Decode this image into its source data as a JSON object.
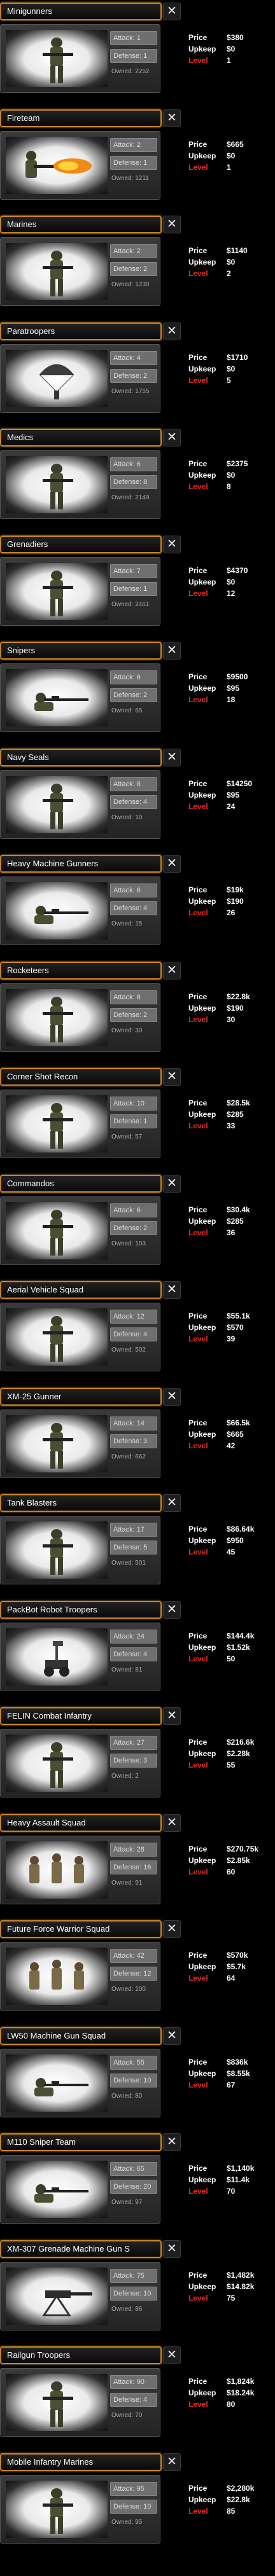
{
  "labels": {
    "attack": "Attack:",
    "defense": "Defense:",
    "owned": "Owned:",
    "price": "Price",
    "upkeep": "Upkeep",
    "level": "Level",
    "close": "✕"
  },
  "units": [
    {
      "name": "Minigunners",
      "attack": "1",
      "defense": "1",
      "owned": "2252",
      "price": "$380",
      "upkeep": "$0",
      "level": "1",
      "figure": "soldier-figure"
    },
    {
      "name": "Fireteam",
      "attack": "2",
      "defense": "1",
      "owned": "1211",
      "price": "$665",
      "upkeep": "$0",
      "level": "1",
      "figure": "flamethrower-figure"
    },
    {
      "name": "Marines",
      "attack": "2",
      "defense": "2",
      "owned": "1230",
      "price": "$1140",
      "upkeep": "$0",
      "level": "2",
      "figure": "soldier-figure"
    },
    {
      "name": "Paratroopers",
      "attack": "4",
      "defense": "2",
      "owned": "1755",
      "price": "$1710",
      "upkeep": "$0",
      "level": "5",
      "figure": "parachute-figure"
    },
    {
      "name": "Medics",
      "attack": "6",
      "defense": "8",
      "owned": "2149",
      "price": "$2375",
      "upkeep": "$0",
      "level": "8",
      "figure": "soldier-figure"
    },
    {
      "name": "Grenadiers",
      "attack": "7",
      "defense": "1",
      "owned": "2461",
      "price": "$4370",
      "upkeep": "$0",
      "level": "12",
      "figure": "soldier-figure"
    },
    {
      "name": "Snipers",
      "attack": "6",
      "defense": "2",
      "owned": "65",
      "price": "$9500",
      "upkeep": "$95",
      "level": "18",
      "figure": "sniper-figure"
    },
    {
      "name": "Navy Seals",
      "attack": "8",
      "defense": "4",
      "owned": "10",
      "price": "$14250",
      "upkeep": "$95",
      "level": "24",
      "figure": "soldier-figure"
    },
    {
      "name": "Heavy Machine Gunners",
      "attack": "6",
      "defense": "4",
      "owned": "15",
      "price": "$19k",
      "upkeep": "$190",
      "level": "26",
      "figure": "sniper-figure"
    },
    {
      "name": "Rocketeers",
      "attack": "8",
      "defense": "2",
      "owned": "30",
      "price": "$22.8k",
      "upkeep": "$190",
      "level": "30",
      "figure": "soldier-figure"
    },
    {
      "name": "Corner Shot Recon",
      "attack": "10",
      "defense": "1",
      "owned": "57",
      "price": "$28.5k",
      "upkeep": "$285",
      "level": "33",
      "figure": "soldier-figure"
    },
    {
      "name": "Commandos",
      "attack": "6",
      "defense": "2",
      "owned": "103",
      "price": "$30.4k",
      "upkeep": "$285",
      "level": "36",
      "figure": "soldier-figure"
    },
    {
      "name": "Aerial Vehicle Squad",
      "attack": "12",
      "defense": "4",
      "owned": "502",
      "price": "$55.1k",
      "upkeep": "$570",
      "level": "39",
      "figure": "soldier-figure"
    },
    {
      "name": "XM-25 Gunner",
      "attack": "14",
      "defense": "3",
      "owned": "662",
      "price": "$66.5k",
      "upkeep": "$665",
      "level": "42",
      "figure": "soldier-figure"
    },
    {
      "name": "Tank Blasters",
      "attack": "17",
      "defense": "5",
      "owned": "501",
      "price": "$86.64k",
      "upkeep": "$950",
      "level": "45",
      "figure": "soldier-figure"
    },
    {
      "name": "PackBot Robot Troopers",
      "attack": "24",
      "defense": "4",
      "owned": "81",
      "price": "$144.4k",
      "upkeep": "$1.52k",
      "level": "50",
      "figure": "robot-figure"
    },
    {
      "name": "FELIN Combat Infantry",
      "attack": "27",
      "defense": "3",
      "owned": "2",
      "price": "$216.6k",
      "upkeep": "$2.28k",
      "level": "55",
      "figure": "soldier-figure"
    },
    {
      "name": "Heavy Assault Squad",
      "attack": "28",
      "defense": "16",
      "owned": "91",
      "price": "$270.75k",
      "upkeep": "$2.85k",
      "level": "60",
      "figure": "squad-figure"
    },
    {
      "name": "Future Force Warrior Squad",
      "attack": "42",
      "defense": "12",
      "owned": "100",
      "price": "$570k",
      "upkeep": "$5.7k",
      "level": "64",
      "figure": "squad-figure"
    },
    {
      "name": "LW50 Machine Gun Squad",
      "attack": "55",
      "defense": "10",
      "owned": "80",
      "price": "$836k",
      "upkeep": "$8.55k",
      "level": "67",
      "figure": "sniper-figure"
    },
    {
      "name": "M110 Sniper Team",
      "attack": "65",
      "defense": "20",
      "owned": "97",
      "price": "$1,140k",
      "upkeep": "$11.4k",
      "level": "70",
      "figure": "sniper-figure"
    },
    {
      "name": "XM-307 Grenade Machine Gun S",
      "attack": "75",
      "defense": "10",
      "owned": "86",
      "price": "$1,482k",
      "upkeep": "$14.82k",
      "level": "75",
      "figure": "turret-figure"
    },
    {
      "name": "Railgun Troopers",
      "attack": "90",
      "defense": "4",
      "owned": "70",
      "price": "$1,824k",
      "upkeep": "$18.24k",
      "level": "80",
      "figure": "soldier-figure"
    },
    {
      "name": "Mobile Infantry Marines",
      "attack": "95",
      "defense": "10",
      "owned": "95",
      "price": "$2,280k",
      "upkeep": "$22.8k",
      "level": "85",
      "figure": "soldier-figure"
    }
  ]
}
